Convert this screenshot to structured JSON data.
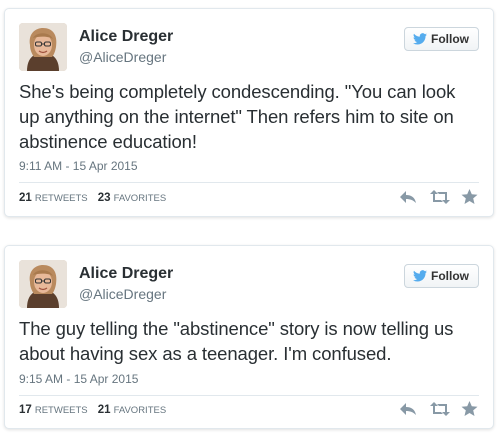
{
  "tweets": [
    {
      "display_name": "Alice Dreger",
      "screen_name": "@AliceDreger",
      "follow_label": "Follow",
      "text": "She's being completely condescending. \"You can look up anything on the internet\" Then refers him to site on abstinence education!",
      "timestamp": "9:11 AM - 15 Apr 2015",
      "retweets": "21",
      "retweets_label": "RETWEETS",
      "favorites": "23",
      "favorites_label": "FAVORITES"
    },
    {
      "display_name": "Alice Dreger",
      "screen_name": "@AliceDreger",
      "follow_label": "Follow",
      "text": "The guy telling the \"abstinence\" story is now telling us about having sex as a teenager. I'm confused.",
      "timestamp": "9:15 AM - 15 Apr 2015",
      "retweets": "17",
      "retweets_label": "RETWEETS",
      "favorites": "21",
      "favorites_label": "FAVORITES"
    }
  ],
  "icons": {
    "follow": "twitter-bird-icon",
    "reply": "reply-icon",
    "retweet": "retweet-icon",
    "favorite": "star-icon"
  },
  "colors": {
    "twitter_blue": "#55acee",
    "text": "#292f33",
    "muted": "#66757f",
    "icon_gray": "#8899a6"
  }
}
